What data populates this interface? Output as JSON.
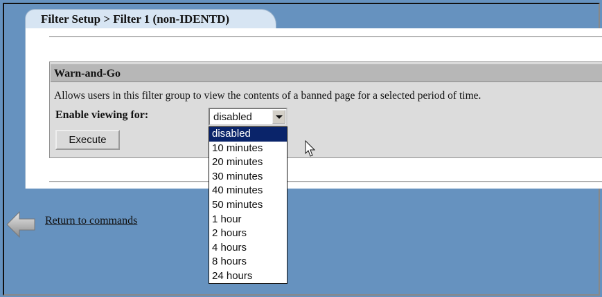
{
  "header": {
    "title": "Filter Setup > Filter 1 (non-IDENTD)"
  },
  "section": {
    "title": "Warn-and-Go",
    "description": "Allows users in this filter group to view the contents of a banned page for a selected period of time.",
    "field_label": "Enable viewing for:",
    "select": {
      "value": "disabled",
      "options": [
        "disabled",
        "10 minutes",
        "20 minutes",
        "30 minutes",
        "40 minutes",
        "50 minutes",
        "1 hour",
        "2 hours",
        "4 hours",
        "8 hours",
        "24 hours"
      ],
      "highlighted_index": 0
    },
    "execute_label": "Execute"
  },
  "footer": {
    "return_link": "Return to commands"
  },
  "colors": {
    "page_background": "#6692bf",
    "tab_background": "#d7e5f3",
    "section_header": "#b7b7b7",
    "selection_highlight": "#0a246a"
  },
  "icons": {
    "back": "back-arrow-icon",
    "cursor": "mouse-cursor-icon",
    "dropdown": "chevron-down-icon"
  }
}
